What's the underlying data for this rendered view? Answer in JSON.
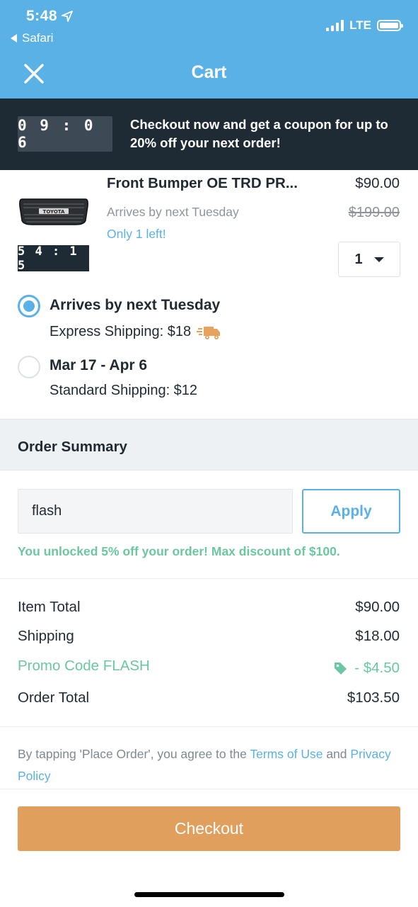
{
  "status_bar": {
    "time": "5:48",
    "back_app": "Safari",
    "network": "LTE",
    "location_icon": "location-arrow-icon",
    "signal_icon": "signal-bars-icon",
    "battery_icon": "battery-icon",
    "battery_level": 1.0
  },
  "nav": {
    "title": "Cart",
    "close_icon": "close-icon"
  },
  "banner": {
    "countdown": "09:06",
    "message": "Checkout now and get a coupon for up to 20% off your next order!"
  },
  "item": {
    "title": "Front Bumper OE TRD PR...",
    "price": "$90.00",
    "original_price": "$199.00",
    "arrival": "Arrives by next Tuesday",
    "stock": "Only 1 left!",
    "countdown": "54:15",
    "quantity": "1",
    "image_brand_text": "TOYOTA"
  },
  "shipping": {
    "options": [
      {
        "title": "Arrives by next Tuesday",
        "detail": "Express Shipping: $18",
        "selected": true,
        "icon": "truck-icon"
      },
      {
        "title": "Mar 17 - Apr 6",
        "detail": "Standard Shipping: $12",
        "selected": false
      }
    ]
  },
  "summary": {
    "heading": "Order Summary",
    "promo_code_value": "flash",
    "apply_label": "Apply",
    "unlocked_message": "You unlocked 5% off your order! Max discount of $100.",
    "rows": {
      "item_total_label": "Item Total",
      "item_total_value": "$90.00",
      "shipping_label": "Shipping",
      "shipping_value": "$18.00",
      "promo_label": "Promo Code FLASH",
      "promo_value": "- $4.50",
      "promo_icon": "tag-icon",
      "order_total_label": "Order Total",
      "order_total_value": "$103.50"
    }
  },
  "legal": {
    "prefix": "By tapping 'Place Order', you agree to the ",
    "terms": "Terms of Use",
    "middle": " and ",
    "privacy": "Privacy Policy"
  },
  "checkout_label": "Checkout",
  "colors": {
    "brand_blue": "#5ab1e6",
    "banner_dark": "#1f2b34",
    "promo_green": "#6cc7a0",
    "checkout_orange": "#e09f5c",
    "truck_orange": "#e8a25f"
  }
}
